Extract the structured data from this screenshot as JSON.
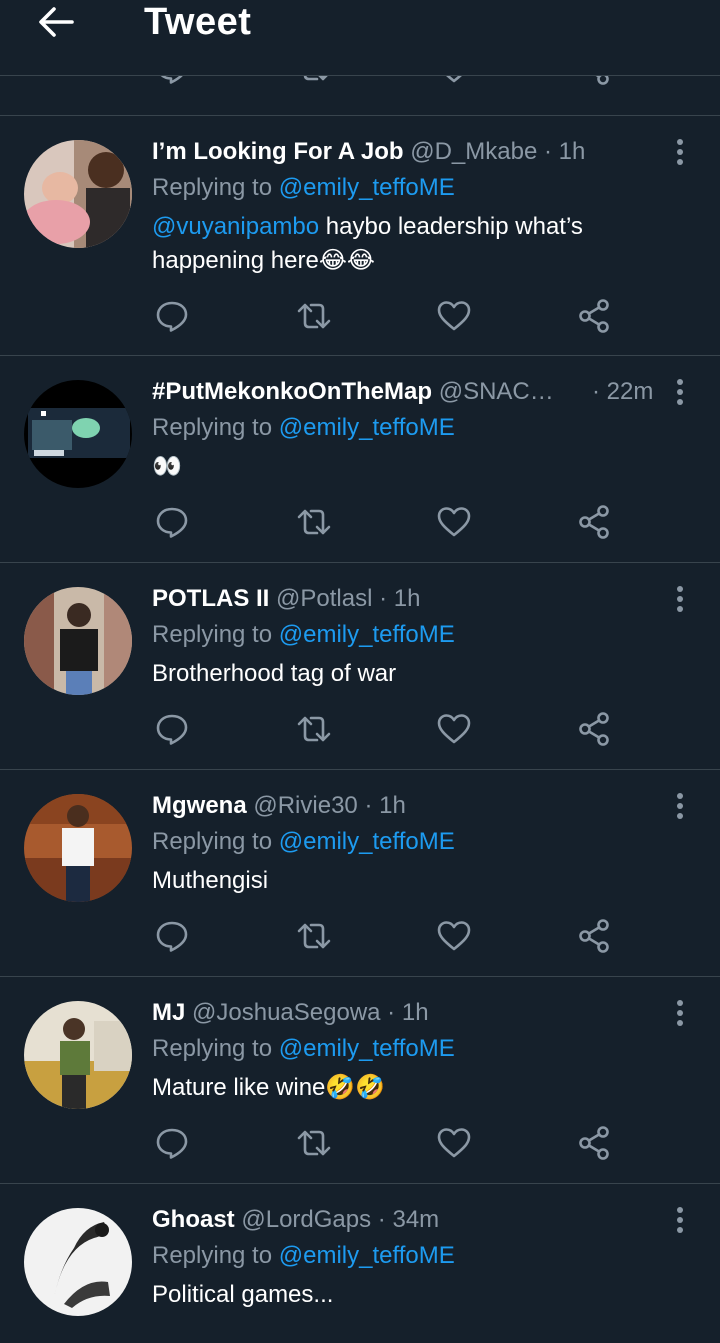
{
  "header": {
    "title": "Tweet"
  },
  "icons": {
    "back": "arrow-left-icon",
    "reply": "reply-bubble-icon",
    "retweet": "retweet-icon",
    "like": "heart-icon",
    "share": "share-icon",
    "more": "more-vertical-icon"
  },
  "colors": {
    "background": "#15202b",
    "link": "#1d9bf0",
    "muted": "#8b98a5",
    "divider": "#38444d"
  },
  "tweets": [
    {
      "name": "I’m Looking For A Job",
      "handle": "@D_Mkabe",
      "sep": "·",
      "time": "1h",
      "replying_prefix": "Replying to ",
      "replying_to": "@emily_teffoME",
      "body_mention": "@vuyanipambo",
      "body": " haybo leadership what’s happening here😂😂"
    },
    {
      "name": "#PutMekonkoOnTheMap",
      "handle": "@SNACH...",
      "sep": "·",
      "time": "22m",
      "replying_prefix": "Replying to ",
      "replying_to": "@emily_teffoME",
      "body_mention": "",
      "body": "👀"
    },
    {
      "name": "POTLAS II",
      "handle": "@Potlasl",
      "sep": "·",
      "time": "1h",
      "replying_prefix": "Replying to ",
      "replying_to": "@emily_teffoME",
      "body_mention": "",
      "body": "Brotherhood tag of war"
    },
    {
      "name": "Mgwena",
      "handle": "@Rivie30",
      "sep": "·",
      "time": "1h",
      "replying_prefix": "Replying to ",
      "replying_to": "@emily_teffoME",
      "body_mention": "",
      "body": "Muthengisi"
    },
    {
      "name": "MJ",
      "handle": "@JoshuaSegowa",
      "sep": "·",
      "time": "1h",
      "replying_prefix": "Replying to ",
      "replying_to": "@emily_teffoME",
      "body_mention": "",
      "body": "Mature like wine🤣🤣"
    },
    {
      "name": "Ghoast",
      "handle": "@LordGaps",
      "sep": "·",
      "time": "34m",
      "replying_prefix": "Replying to ",
      "replying_to": "@emily_teffoME",
      "body_mention": "",
      "body": "Political games..."
    }
  ]
}
